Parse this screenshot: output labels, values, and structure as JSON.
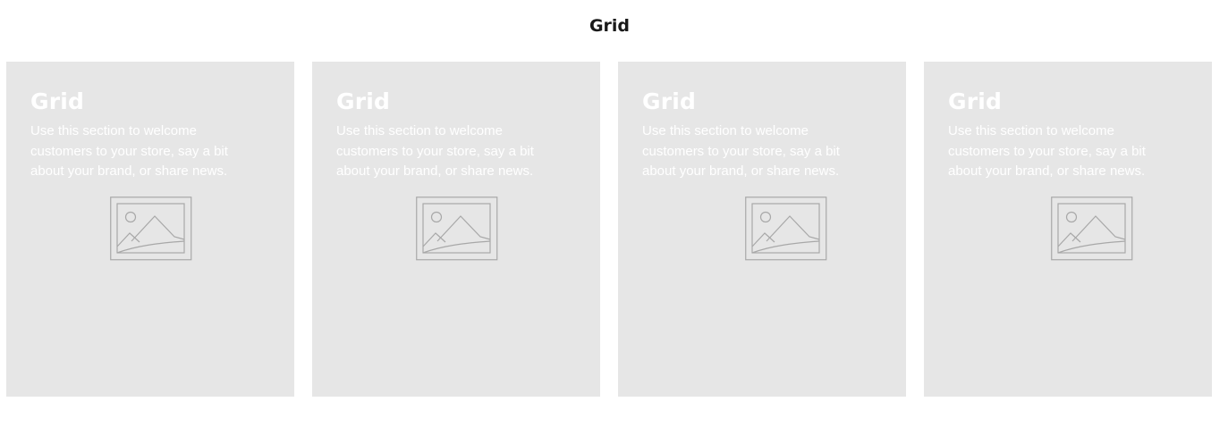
{
  "section": {
    "title": "Grid"
  },
  "cards": [
    {
      "title": "Grid",
      "text": "Use this section to welcome customers to your store, say a bit about your brand, or share news.",
      "image_icon": "image-placeholder-icon"
    },
    {
      "title": "Grid",
      "text": "Use this section to welcome customers to your store, say a bit about your brand, or share news.",
      "image_icon": "image-placeholder-icon"
    },
    {
      "title": "Grid",
      "text": "Use this section to welcome customers to your store, say a bit about your brand, or share news.",
      "image_icon": "image-placeholder-icon"
    },
    {
      "title": "Grid",
      "text": "Use this section to welcome customers to your store, say a bit about your brand, or share news.",
      "image_icon": "image-placeholder-icon"
    }
  ],
  "colors": {
    "card_background": "#e6e6e6",
    "card_text": "#ffffff",
    "heading": "#1a1a1a",
    "placeholder_stroke": "#a8a8a8"
  }
}
